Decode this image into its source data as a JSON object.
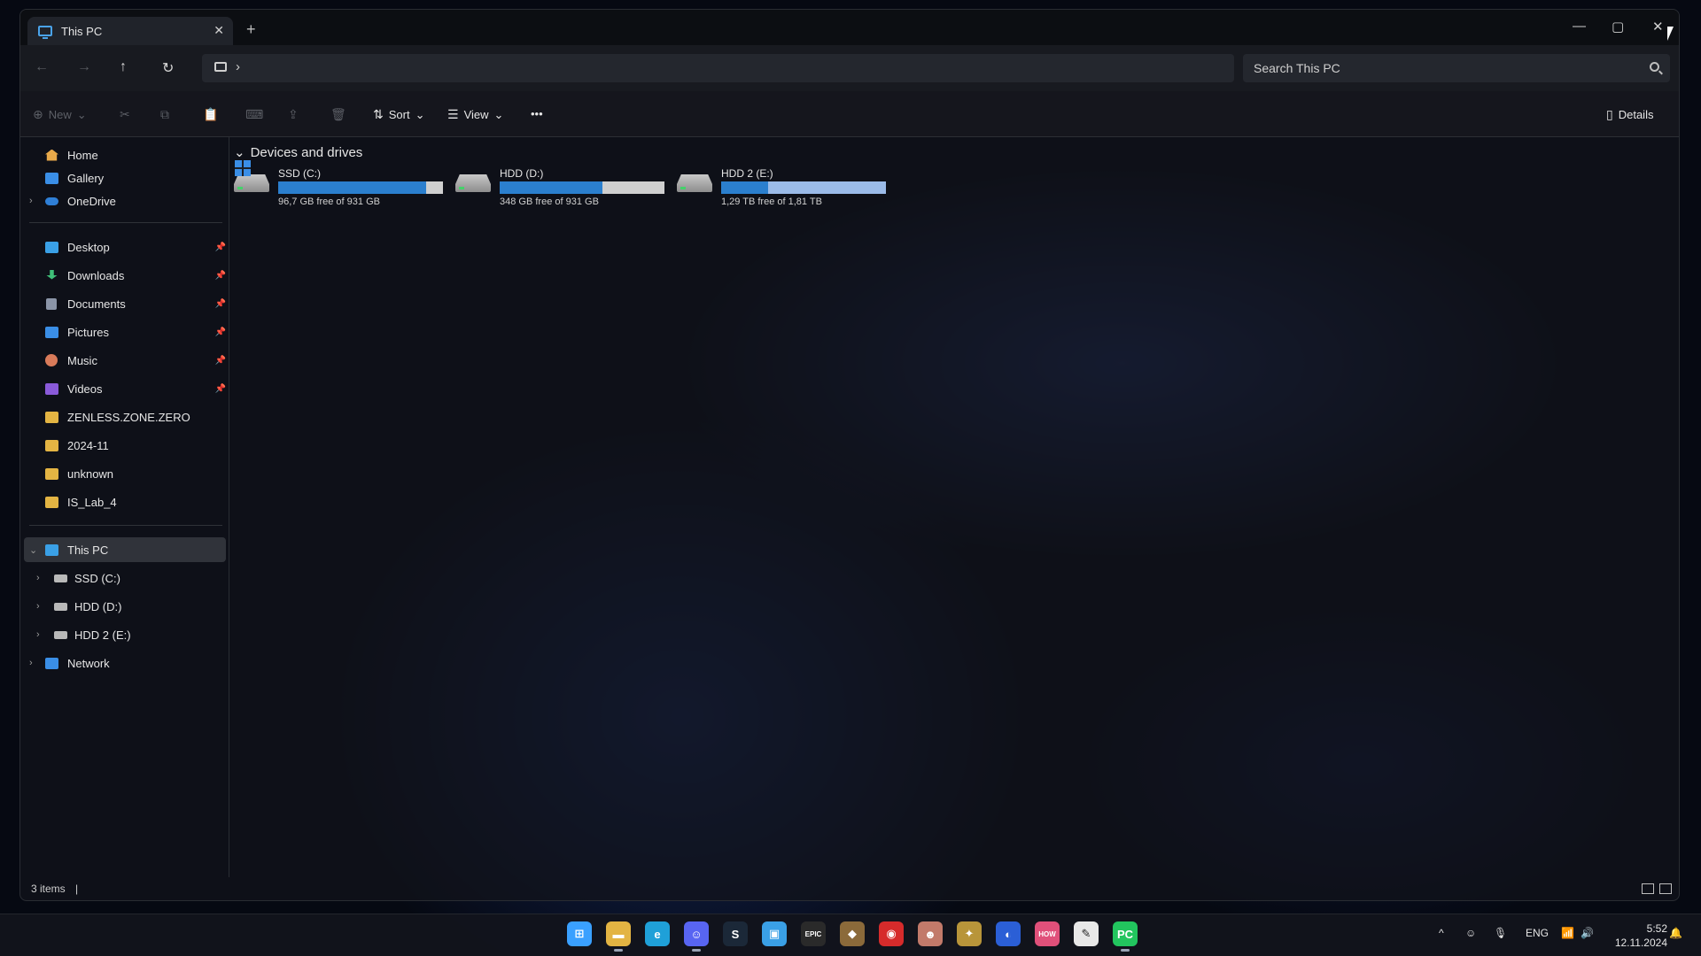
{
  "window": {
    "tab_title": "This PC",
    "tab_close": "✕",
    "new_tab": "+",
    "controls": {
      "minimize": "—",
      "maximize": "▢",
      "close": "✕"
    }
  },
  "nav": {
    "back": "←",
    "forward": "→",
    "up": "↑",
    "refresh": "↻",
    "breadcrumb_chevron": "›",
    "search_placeholder": "Search This PC"
  },
  "toolbar": {
    "new_label": "New",
    "sort_label": "Sort",
    "view_label": "View",
    "more_label": "•••",
    "details_label": "Details",
    "icons": {
      "new": "⊕",
      "cut": "✂",
      "copy": "⧉",
      "paste": "📋",
      "rename": "⌨",
      "share": "⇪",
      "delete": "🗑",
      "sort": "⇅",
      "view": "☰",
      "details": "▯"
    }
  },
  "sidebar": {
    "quick": [
      {
        "label": "Home",
        "icon": "home-icon",
        "color": "#e8a94a"
      },
      {
        "label": "Gallery",
        "icon": "gallery-icon",
        "color": "#3a8ee6"
      },
      {
        "label": "OneDrive",
        "icon": "cloud-icon",
        "color": "#2f7fd6"
      }
    ],
    "pinned": [
      {
        "label": "Desktop",
        "icon": "desktop-icon",
        "color": "#3aa0e6",
        "pin": "📌"
      },
      {
        "label": "Downloads",
        "icon": "download-icon",
        "color": "#3fbf78",
        "pin": "📌"
      },
      {
        "label": "Documents",
        "icon": "documents-icon",
        "color": "#8b95a8",
        "pin": "📌"
      },
      {
        "label": "Pictures",
        "icon": "pictures-icon",
        "color": "#3a8ee6",
        "pin": "📌"
      },
      {
        "label": "Music",
        "icon": "music-icon",
        "color": "#d97b5a",
        "pin": "📌"
      },
      {
        "label": "Videos",
        "icon": "videos-icon",
        "color": "#8a5ad9",
        "pin": "📌"
      },
      {
        "label": "ZENLESS.ZONE.ZERO",
        "icon": "folder-icon",
        "color": "#e3b443"
      },
      {
        "label": "2024-11",
        "icon": "folder-icon",
        "color": "#e3b443"
      },
      {
        "label": "unknown",
        "icon": "folder-icon",
        "color": "#e3b443"
      },
      {
        "label": "IS_Lab_4",
        "icon": "folder-icon",
        "color": "#e3b443"
      }
    ],
    "tree": {
      "this_pc": "This PC",
      "drives": [
        "SSD (C:)",
        "HDD (D:)",
        "HDD 2 (E:)"
      ],
      "network": "Network"
    }
  },
  "content": {
    "section_title": "Devices and drives",
    "drives": [
      {
        "name": "SSD (C:)",
        "free_text": "96,7 GB free of 931 GB",
        "used_fraction": 0.896,
        "fill": "#2b7fce"
      },
      {
        "name": "HDD (D:)",
        "free_text": "348 GB free of 931 GB",
        "used_fraction": 0.626,
        "fill": "#2b7fce"
      },
      {
        "name": "HDD 2 (E:)",
        "free_text": "1,29 TB free of 1,81 TB",
        "used_fraction": 0.287,
        "fill": "#2b7fce"
      }
    ]
  },
  "status": {
    "items_text": "3 items",
    "separator": "|"
  },
  "taskbar": {
    "apps": [
      {
        "name": "start",
        "glyph": "⊞",
        "color": "#3aa0ff"
      },
      {
        "name": "file-explorer",
        "glyph": "▬",
        "color": "#e3b443",
        "active": true
      },
      {
        "name": "edge",
        "glyph": "e",
        "color": "#1fa0d8"
      },
      {
        "name": "discord",
        "glyph": "☺",
        "color": "#5865f2",
        "active": true
      },
      {
        "name": "steam",
        "glyph": "S",
        "color": "#1b2838"
      },
      {
        "name": "store",
        "glyph": "▣",
        "color": "#3aa0e6"
      },
      {
        "name": "epic-games",
        "glyph": "EPIC",
        "color": "#2a2a2a"
      },
      {
        "name": "app-cube",
        "glyph": "◆",
        "color": "#8b6a3a"
      },
      {
        "name": "app-red",
        "glyph": "◉",
        "color": "#d62b2b"
      },
      {
        "name": "app-face",
        "glyph": "☻",
        "color": "#c27a6a"
      },
      {
        "name": "app-game",
        "glyph": "✦",
        "color": "#b8953a"
      },
      {
        "name": "app-blue",
        "glyph": "◐",
        "color": "#2b5fd6"
      },
      {
        "name": "app-pink",
        "glyph": "HOW",
        "color": "#e0507a"
      },
      {
        "name": "app-notes",
        "glyph": "✎",
        "color": "#e8e8e8"
      },
      {
        "name": "pycharm",
        "glyph": "PC",
        "color": "#22c55e",
        "active": true
      }
    ],
    "tray": {
      "chevron": "^",
      "discord": "☺",
      "mic": "🎙",
      "lang": "ENG",
      "wifi": "📶",
      "volume": "🔊",
      "time": "5:52",
      "date": "12.11.2024",
      "bell": "🔔"
    }
  }
}
